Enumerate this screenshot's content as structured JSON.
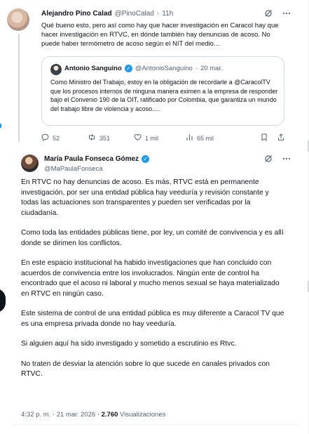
{
  "reply_tweet": {
    "author_name": "Alejandro Pino Calad",
    "author_handle": "@PinoCalad",
    "separator": "·",
    "time": "11h",
    "text": "Qué bueno esto, pero así como hay que hacer investigación en Caracol hay que hacer investigación en RTVC, en dónde también hay denuncias de acoso. No puede haber termómetro de acoso según el NIT del medio…",
    "quoted": {
      "author_name": "Antonio Sanguino",
      "author_handle": "@AntonioSanguino",
      "separator": "·",
      "date": "20 mar.",
      "text": "Como Ministro del Trabajo, estoy en la obligación de recordarle a @CaracolTV que los procesos internos de ninguna manera eximen a la empresa de responder bajo el Convenio 190 de la OIT, ratificado por Colombia, que garantiza un mundo del trabajo libre de violencia y acoso.…"
    },
    "actions": {
      "replies": "52",
      "reposts": "351",
      "likes": "1 mil",
      "views": "65 mil"
    }
  },
  "main_tweet": {
    "author_name": "María Paula Fonseca Gómez",
    "author_handle": "@MaPaulaFonseca",
    "paragraphs": [
      "En RTVC no hay denuncias de acoso. Es más, RTVC está en permanente investigación, por ser una entidad pública hay veeduría y revisión constante y todas las actuaciones son transparentes y pueden ser verificadas por la ciudadanía.",
      "Como toda las entidades públicas tiene, por ley, un comité de convivencia y es allí donde se dirimen los conflictos.",
      "En este espacio institucional ha habido investigaciones que han concluido con acuerdos de convivencia entre los involucrados. Ningún ente de control ha encontrado que el acoso ni laboral y mucho menos sexual se haya materializado en RTVC en ningún caso.",
      "Este sistema de control de una entidad pública es muy diferente a Caracol TV que es una empresa privada donde no hay veeduría.",
      "Si alguien aquí ha sido investigado y sometido a escrutinio es Rtvc.",
      "No traten de desviar la atención sobre lo que sucede en canales privados con RTVC."
    ],
    "time": "4:32 p. m.",
    "separator": "·",
    "date": "21 mar. 2026",
    "views_count": "2.760",
    "views_label": "Visualizaciones"
  },
  "icons": {
    "grok": "grok-icon",
    "more": "more-icon",
    "verified": "verified-badge-icon",
    "reply": "reply-icon",
    "repost": "repost-icon",
    "like": "like-icon",
    "views": "views-icon",
    "bookmark": "bookmark-icon",
    "share": "share-icon"
  },
  "colors": {
    "text": "#0f1419",
    "muted": "#536471",
    "accent": "#1d9bf0",
    "border": "#cfd9de"
  }
}
